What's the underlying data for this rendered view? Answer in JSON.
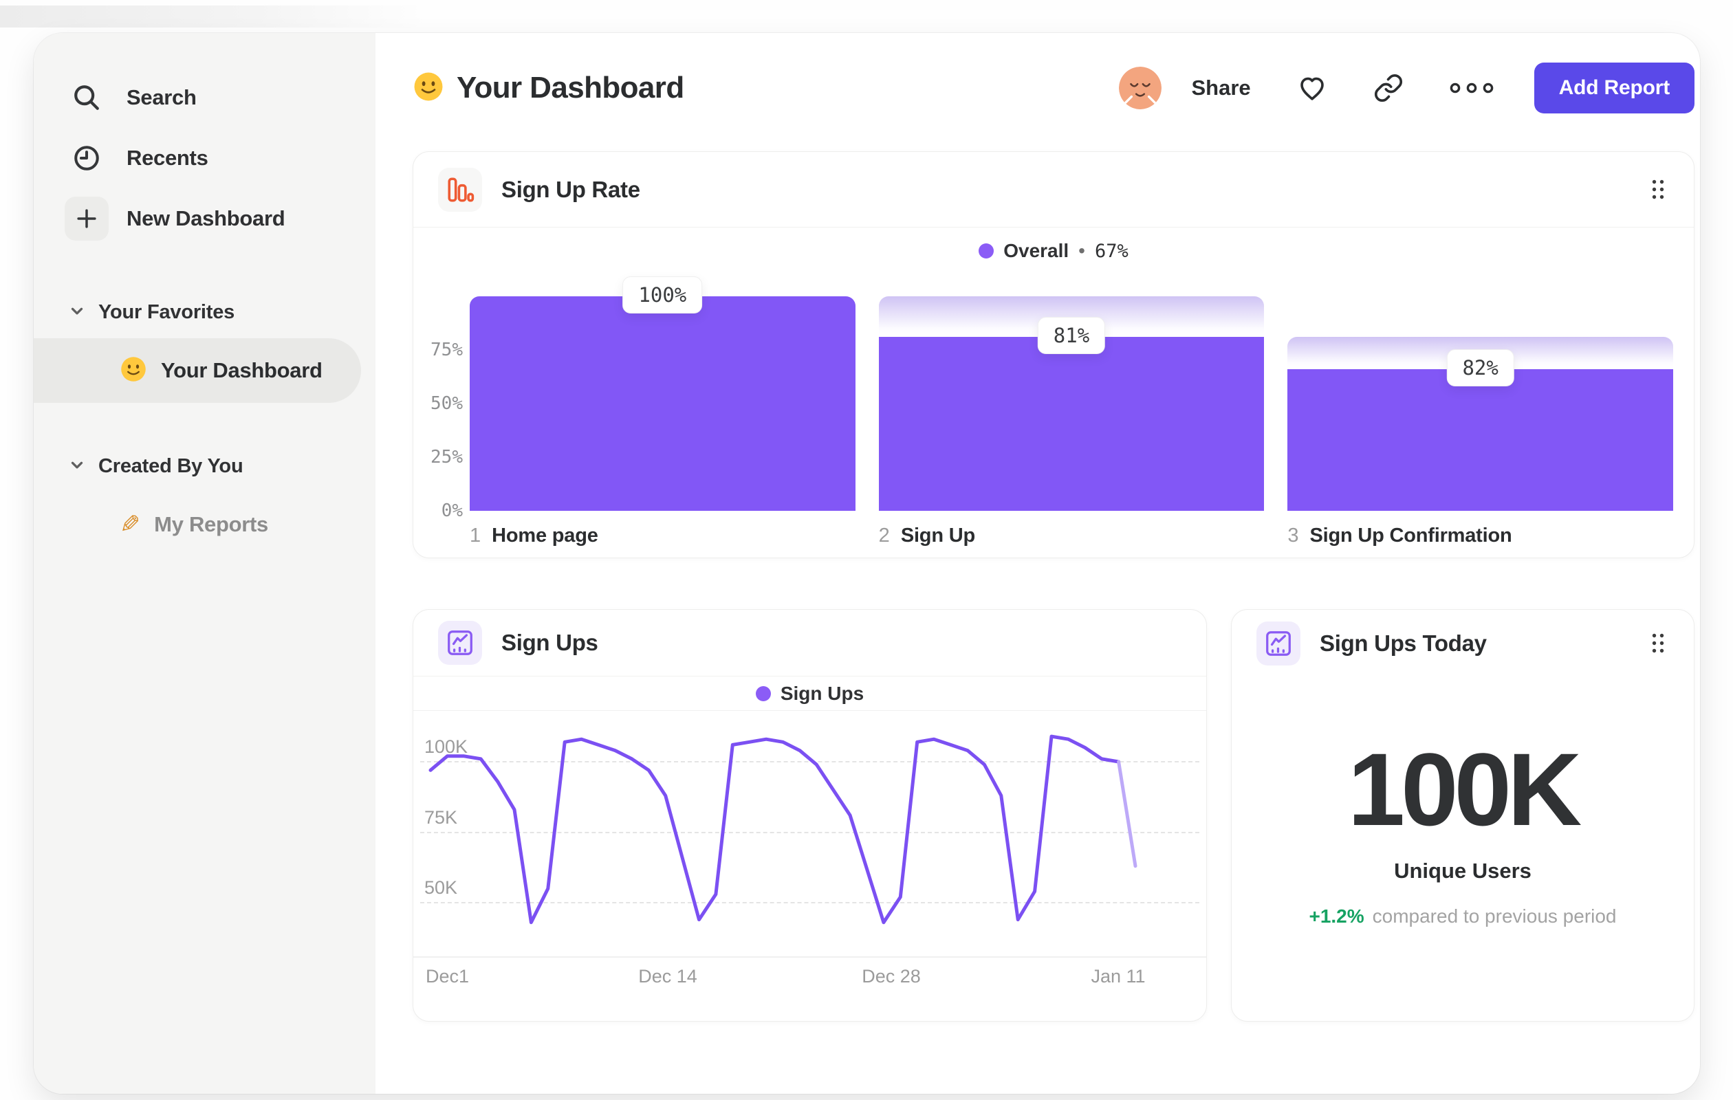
{
  "sidebar": {
    "nav": [
      {
        "label": "Search"
      },
      {
        "label": "Recents"
      },
      {
        "label": "New Dashboard"
      }
    ],
    "favorites_section": {
      "label": "Your Favorites"
    },
    "favorites_items": [
      {
        "label": "Your Dashboard"
      }
    ],
    "created_section": {
      "label": "Created By You"
    },
    "created_items": [
      {
        "label": "My Reports"
      }
    ]
  },
  "header": {
    "title": "Your Dashboard",
    "share": "Share",
    "add_report": "Add Report"
  },
  "funnel_card": {
    "title": "Sign Up Rate",
    "legend_label": "Overall",
    "legend_sep": "•",
    "legend_value": "67%",
    "y_ticks": [
      {
        "label": "75%",
        "pct": 75
      },
      {
        "label": "50%",
        "pct": 50
      },
      {
        "label": "25%",
        "pct": 25
      },
      {
        "label": "0%",
        "pct": 0
      }
    ],
    "steps": [
      {
        "index": "1",
        "label": "Home page",
        "pct": 100,
        "prev": 100,
        "tooltip": "100%"
      },
      {
        "index": "2",
        "label": "Sign Up",
        "pct": 81,
        "prev": 100,
        "tooltip": "81%"
      },
      {
        "index": "3",
        "label": "Sign Up Confirmation",
        "pct": 66,
        "prev": 81,
        "tooltip": "82%"
      }
    ]
  },
  "line_card": {
    "title": "Sign Ups",
    "legend": "Sign Ups",
    "y_ticks": [
      {
        "label": "100K",
        "value": 100
      },
      {
        "label": "75K",
        "value": 75
      },
      {
        "label": "50K",
        "value": 50
      }
    ],
    "x_ticks": [
      "Dec1",
      "Dec 14",
      "Dec 28",
      "Jan 11"
    ],
    "values_k": [
      97,
      102,
      102,
      101,
      93,
      83,
      43,
      55,
      107,
      108,
      106,
      104,
      101,
      97,
      88,
      66,
      44,
      53,
      106,
      107,
      108,
      107,
      104,
      99,
      90,
      81,
      62,
      43,
      52,
      107,
      108,
      106,
      104,
      99,
      88,
      44,
      54,
      109,
      108,
      105,
      101,
      100,
      63
    ],
    "faded_tail_segments": 1
  },
  "stat_card": {
    "title": "Sign Ups Today",
    "value": "100K",
    "label": "Unique Users",
    "delta": "+1.2%",
    "caption": "compared to previous period"
  },
  "colors": {
    "bar_purple": "#8257F6",
    "line_purple": "#7B50F2",
    "line_faded": "#BDA9F8",
    "legend_dot": "#8B5CF6",
    "button_purple": "#5A49E9",
    "icon_orange": "#EE5B33",
    "icon_purple": "#8A5BF3",
    "delta_green": "#16A262"
  },
  "chart_data": [
    {
      "type": "bar",
      "subtype": "funnel",
      "title": "Sign Up Rate",
      "legend": "Overall • 67%",
      "categories": [
        "Home page",
        "Sign Up",
        "Sign Up Confirmation"
      ],
      "values": [
        100,
        81,
        66
      ],
      "step_labels": [
        "100%",
        "81%",
        "82%"
      ],
      "ylabel": "",
      "xlabel": "",
      "yticks": [
        "0%",
        "25%",
        "50%",
        "75%"
      ],
      "ylim": [
        0,
        100
      ],
      "legend_position": "top-center"
    },
    {
      "type": "line",
      "title": "Sign Ups",
      "legend": "Sign Ups",
      "x_ticks": [
        "Dec1",
        "Dec 14",
        "Dec 28",
        "Jan 11"
      ],
      "unit": "K users",
      "values": [
        97,
        102,
        102,
        101,
        93,
        83,
        43,
        55,
        107,
        108,
        106,
        104,
        101,
        97,
        88,
        66,
        44,
        53,
        106,
        107,
        108,
        107,
        104,
        99,
        90,
        81,
        62,
        43,
        52,
        107,
        108,
        106,
        104,
        99,
        88,
        44,
        54,
        109,
        108,
        105,
        101,
        100,
        63
      ],
      "gridlines": [
        50,
        75,
        100
      ],
      "ylim": [
        31,
        118
      ],
      "grid": "dashed-horizontal",
      "note": "final segment rendered faded (incomplete period)"
    },
    {
      "type": "stat",
      "title": "Sign Ups Today",
      "value": "100K",
      "label": "Unique Users",
      "delta": "+1.2%",
      "caption": "compared to previous period"
    }
  ]
}
